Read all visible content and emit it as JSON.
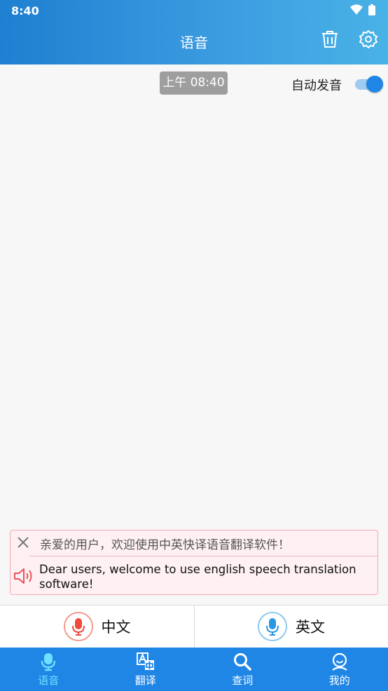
{
  "status_bar": {
    "time": "8:40"
  },
  "header": {
    "title": "语音"
  },
  "chat": {
    "timestamp": "上午 08:40",
    "auto_speak_label": "自动发音",
    "auto_speak_on": true
  },
  "welcome": {
    "chinese": "亲爱的用户，欢迎使用中英快译语音翻译软件！",
    "english": "Dear users, welcome to use english speech translation software!"
  },
  "languages": {
    "chinese_label": "中文",
    "english_label": "英文"
  },
  "nav": {
    "items": [
      {
        "label": "语音",
        "icon": "mic-icon",
        "active": true
      },
      {
        "label": "翻译",
        "icon": "translate-icon",
        "active": false
      },
      {
        "label": "查词",
        "icon": "search-icon",
        "active": false
      },
      {
        "label": "我的",
        "icon": "profile-icon",
        "active": false
      }
    ]
  },
  "colors": {
    "primary": "#1f86e6",
    "header_end": "#49b2e6",
    "active_nav": "#6fe0ff",
    "card_bg": "#fff1f3",
    "card_border": "#f3aab4"
  }
}
